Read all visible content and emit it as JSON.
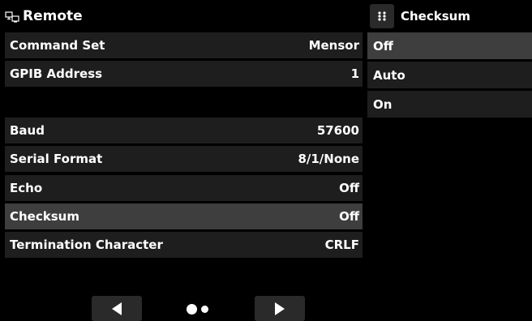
{
  "header": {
    "title": "Remote",
    "icon": "remote-connection-icon"
  },
  "settings": [
    {
      "label": "Command Set",
      "value": "Mensor"
    },
    {
      "label": "GPIB Address",
      "value": "1"
    },
    {
      "label": "",
      "value": ""
    },
    {
      "label": "Baud",
      "value": "57600"
    },
    {
      "label": "Serial Format",
      "value": "8/1/None"
    },
    {
      "label": "Echo",
      "value": "Off"
    },
    {
      "label": "Checksum",
      "value": "Off",
      "selected": true
    },
    {
      "label": "Termination Character",
      "value": "CRLF"
    }
  ],
  "panel": {
    "title": "Checksum",
    "icon": "grip-menu-icon",
    "options": [
      {
        "label": "Off",
        "selected": true
      },
      {
        "label": "Auto"
      },
      {
        "label": "On"
      }
    ]
  },
  "pager": {
    "current_page": 1,
    "total_pages": 2
  },
  "colors": {
    "background": "#000000",
    "row": "#1e1e1e",
    "row_selected": "#3e3e3e",
    "text": "#ffffff"
  }
}
